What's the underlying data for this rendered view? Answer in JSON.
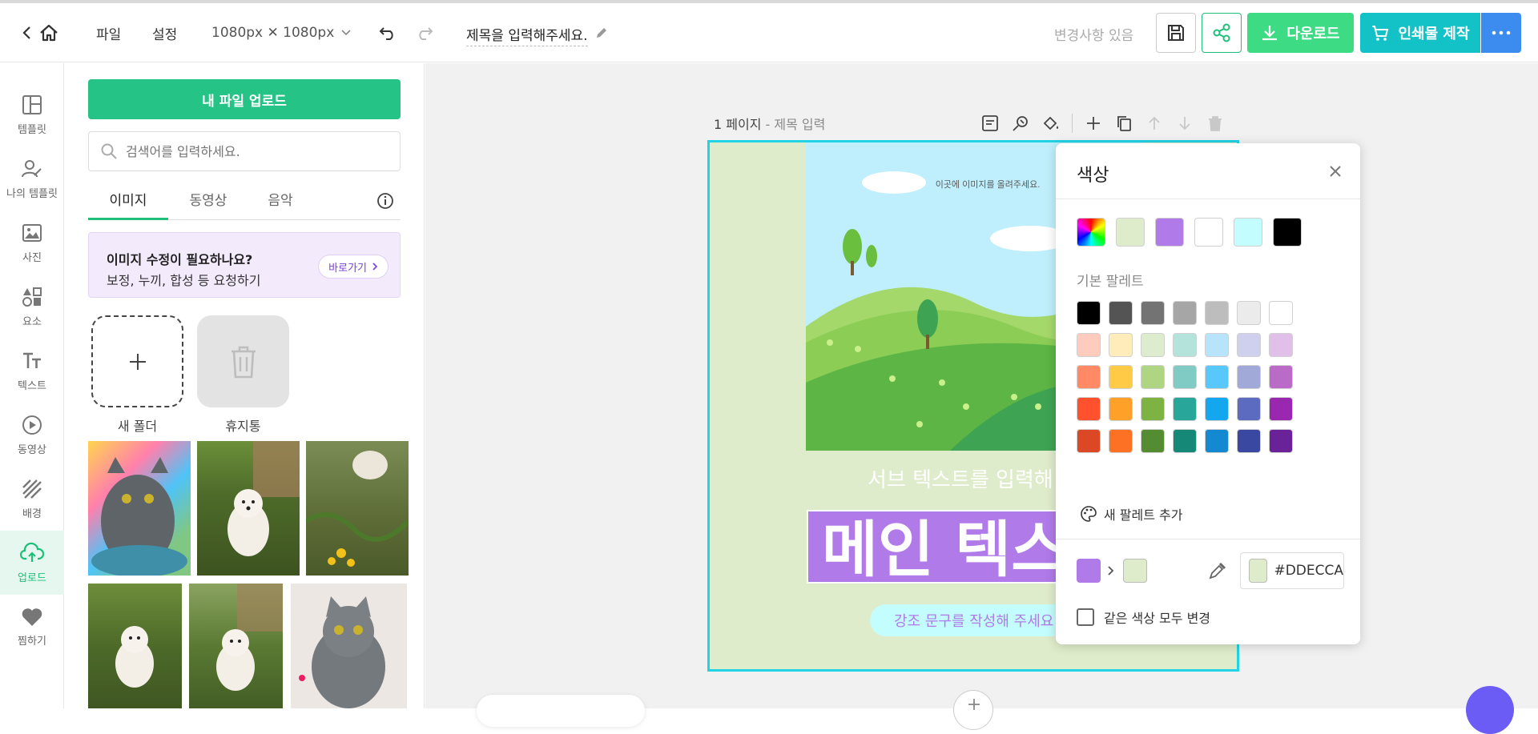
{
  "header": {
    "file_menu": "파일",
    "settings_menu": "설정",
    "canvas_size": "1080px ✕ 1080px",
    "doc_title": "제목을 입력해주세요.",
    "changes_status": "변경사항 있음",
    "download_label": "다운로드",
    "print_label": "인쇄물 제작"
  },
  "sidebar": {
    "items": [
      {
        "label": "템플릿",
        "icon": "layout-icon"
      },
      {
        "label": "나의 템플릿",
        "icon": "user-edit-icon"
      },
      {
        "label": "사진",
        "icon": "image-icon"
      },
      {
        "label": "요소",
        "icon": "shapes-icon"
      },
      {
        "label": "텍스트",
        "icon": "text-icon"
      },
      {
        "label": "동영상",
        "icon": "play-icon"
      },
      {
        "label": "배경",
        "icon": "background-icon"
      },
      {
        "label": "업로드",
        "icon": "cloud-upload-icon"
      },
      {
        "label": "찜하기",
        "icon": "heart-icon"
      }
    ]
  },
  "panel": {
    "upload_button": "내 파일 업로드",
    "search_placeholder": "검색어를 입력하세요.",
    "tabs": [
      "이미지",
      "동영상",
      "음악"
    ],
    "promo_title": "이미지 수정이 필요하나요?",
    "promo_desc": "보정, 누끼, 합성 등 요청하기",
    "promo_link": "바로가기",
    "new_folder": "새 폴더",
    "trash": "휴지통"
  },
  "page": {
    "page_number": "1 페이지",
    "page_subtitle": " - 제목 입력"
  },
  "artboard": {
    "image_hint": "이곳에 이미지를 올려주세요.",
    "sub_text": "서브 텍스트를 입력해 주",
    "main_text": "메인 텍스",
    "emphasis_text": "강조 문구를 작성해 주세요"
  },
  "color_popup": {
    "title": "색상",
    "palette_title": "기본 팔레트",
    "recent_colors": [
      "#dfeccb",
      "#b07ae8",
      "#ffffff",
      "#c4fdfd",
      "#000000"
    ],
    "palette": [
      [
        "#000000",
        "#545454",
        "#737373",
        "#a6a6a6",
        "#bdbdbd",
        "#ebebeb",
        "#ffffff"
      ],
      [
        "#ffcbbd",
        "#ffecbb",
        "#ddeccc",
        "#b4e3dc",
        "#b7e4fb",
        "#cfd0ee",
        "#e0bfe8"
      ],
      [
        "#ff8a65",
        "#ffca45",
        "#aed581",
        "#80cbc4",
        "#58c8fb",
        "#a1a9d8",
        "#ba6bc8"
      ],
      [
        "#ff512e",
        "#ffa129",
        "#7cb342",
        "#29a69a",
        "#14a6ef",
        "#5c6bc0",
        "#9a27b0"
      ],
      [
        "#dc4826",
        "#fd7124",
        "#548c32",
        "#158878",
        "#1488d1",
        "#3a48a2",
        "#6a2299"
      ]
    ],
    "add_palette": "새 팔레트 추가",
    "from_color": "#b07ae8",
    "to_color": "#dfeccb",
    "hex_value": "#DDECCA",
    "same_color_label": "같은 색상 모두 변경"
  }
}
